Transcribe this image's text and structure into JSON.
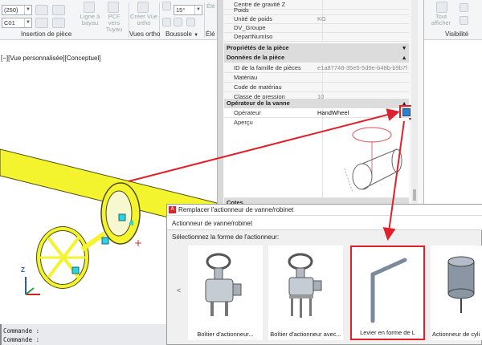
{
  "ribbon": {
    "combo1": "(250)",
    "combo2": "C01",
    "ligne_a_bayau": "Ligne à bayau",
    "pcf_vers_tuyau": "PCF vers Tuyau",
    "creer_vue_ortho": "Créer Vue ortho",
    "angle_value": "15°",
    "elev_partial": "Élé",
    "insertion_de_piece": "Insertion de pièce",
    "vues_ortho": "Vues ortho",
    "boussole": "Boussole",
    "elev_group": "Élé",
    "tout_afficher": "Tout afficher",
    "visibilite": "Visibilité"
  },
  "viewport": {
    "view_label": "[−][Vue personnalisée][Conceptuel]"
  },
  "properties": {
    "top_rows": [
      {
        "k": "Centre de gravité Z",
        "v": ""
      },
      {
        "k": "Poids",
        "v": ""
      },
      {
        "k": "Unité de poids",
        "v": "KG"
      },
      {
        "k": "DV_Groupe",
        "v": ""
      },
      {
        "k": "DepartNumIso",
        "v": ""
      }
    ],
    "section_proprietes": "Propriétés de la pièce",
    "section_donnees": "Données de la pièce",
    "donnees_rows": [
      {
        "k": "ID de la famille de pièces",
        "v": "e1a87748-35e5-5d9e-b48b-b9b7fe..."
      },
      {
        "k": "Matériau",
        "v": ""
      },
      {
        "k": "Code de matériau",
        "v": ""
      },
      {
        "k": "Classe de pression",
        "v": "10"
      }
    ],
    "section_operateur": "Opérateur de la vanne",
    "operateur_label": "Opérateur",
    "operateur_value": "HandWheel",
    "apercu_label": "Aperçu",
    "cotes_label": "Cotes"
  },
  "dialog": {
    "title": "Remplacer l'actionneur de vanne/robinet",
    "header": "Actionneur de vanne/robinet",
    "prompt": "Sélectionnez la forme de l'actionneur:",
    "scroll_left": "<",
    "tiles": [
      {
        "caption": "Boîtier d'actionneur..."
      },
      {
        "caption": "Boîtier d'actionneur avec..."
      },
      {
        "caption": "Levier en forme de L"
      },
      {
        "caption": "Actionneur de cyli"
      }
    ]
  },
  "command": {
    "line1": "Commande :",
    "line2": "Commande :"
  },
  "colors": {
    "pipe": "#f4f42e",
    "highlight": "#e0202a",
    "accent": "#2f7fd1"
  }
}
